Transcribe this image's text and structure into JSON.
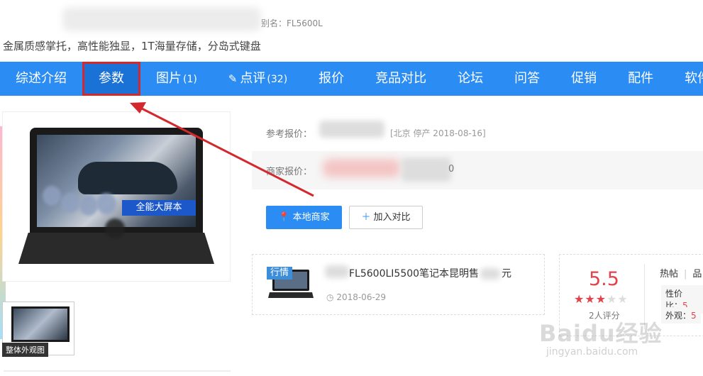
{
  "header": {
    "alias_text": "别名：FL5600L",
    "subtitle": "金属质感掌托，高性能独显，1T海量存储，分岛式键盘"
  },
  "nav": {
    "items": [
      {
        "label": "综述介绍",
        "count": ""
      },
      {
        "label": "参数",
        "count": "",
        "active": true
      },
      {
        "label": "图片",
        "count": "(1)"
      },
      {
        "label": "点评",
        "count": "(32)",
        "icon": "pencil-icon"
      },
      {
        "label": "报价",
        "count": ""
      },
      {
        "label": "竞品对比",
        "count": ""
      },
      {
        "label": "论坛",
        "count": ""
      },
      {
        "label": "问答",
        "count": ""
      },
      {
        "label": "促销",
        "count": ""
      },
      {
        "label": "配件",
        "count": ""
      },
      {
        "label": "软件",
        "count": ""
      }
    ]
  },
  "gallery": {
    "banner_text": "全能大屏本",
    "thumb_label": "整体外观图"
  },
  "price": {
    "ref_label": "参考报价：",
    "ref_note": "[北京 停产 2018-08-16]",
    "dealer_label": "商家报价：",
    "dealer_suffix": "0"
  },
  "actions": {
    "local_dealer": "本地商家",
    "add_compare": "加入对比"
  },
  "news": {
    "tag": "行情",
    "title": "FL5600LI5500笔记本昆明售",
    "title_suffix": "元",
    "date": "2018-06-29"
  },
  "rating": {
    "score": "5.5",
    "count_text": "2人评分",
    "hot_label": "热帖",
    "hot_partial": "品",
    "perf_label": "性价比：",
    "perf_value": "5",
    "look_label": "外观：",
    "look_value": "5"
  },
  "watermark": {
    "brand": "Baidu经验",
    "url": "jingyan.baidu.com"
  },
  "colors": {
    "nav_bg": "#2b8cf3",
    "active_border": "#d2282e",
    "accent_red": "#e1434b"
  }
}
